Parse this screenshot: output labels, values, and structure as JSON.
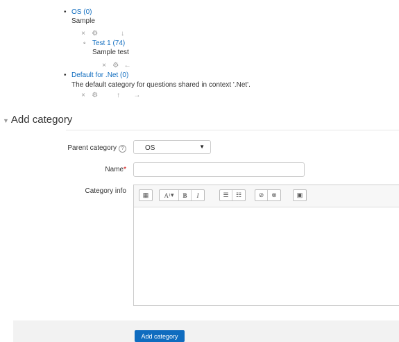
{
  "categories": [
    {
      "name": "OS",
      "count": "(0)",
      "description": "Sample",
      "children": [
        {
          "name": "Test 1",
          "count": "(74)",
          "description": "Sample test"
        }
      ]
    },
    {
      "name": "Default for .Net",
      "count": "(0)",
      "description": "The default category for questions shared in context '.Net'."
    }
  ],
  "icons": {
    "delete": "×",
    "settings": "⚙",
    "down": "↓",
    "left": "←",
    "up": "↑",
    "right": "→"
  },
  "section": {
    "title": "Add category"
  },
  "form": {
    "parent_category_label": "Parent category",
    "parent_category_value": "OS",
    "name_label": "Name",
    "required_marker": "*",
    "name_value": "",
    "category_info_label": "Category info",
    "submit_label": "Add category"
  },
  "colors": {
    "link": "#0f6cbf",
    "primary_button": "#0f6cbf",
    "required": "#cc0000"
  }
}
